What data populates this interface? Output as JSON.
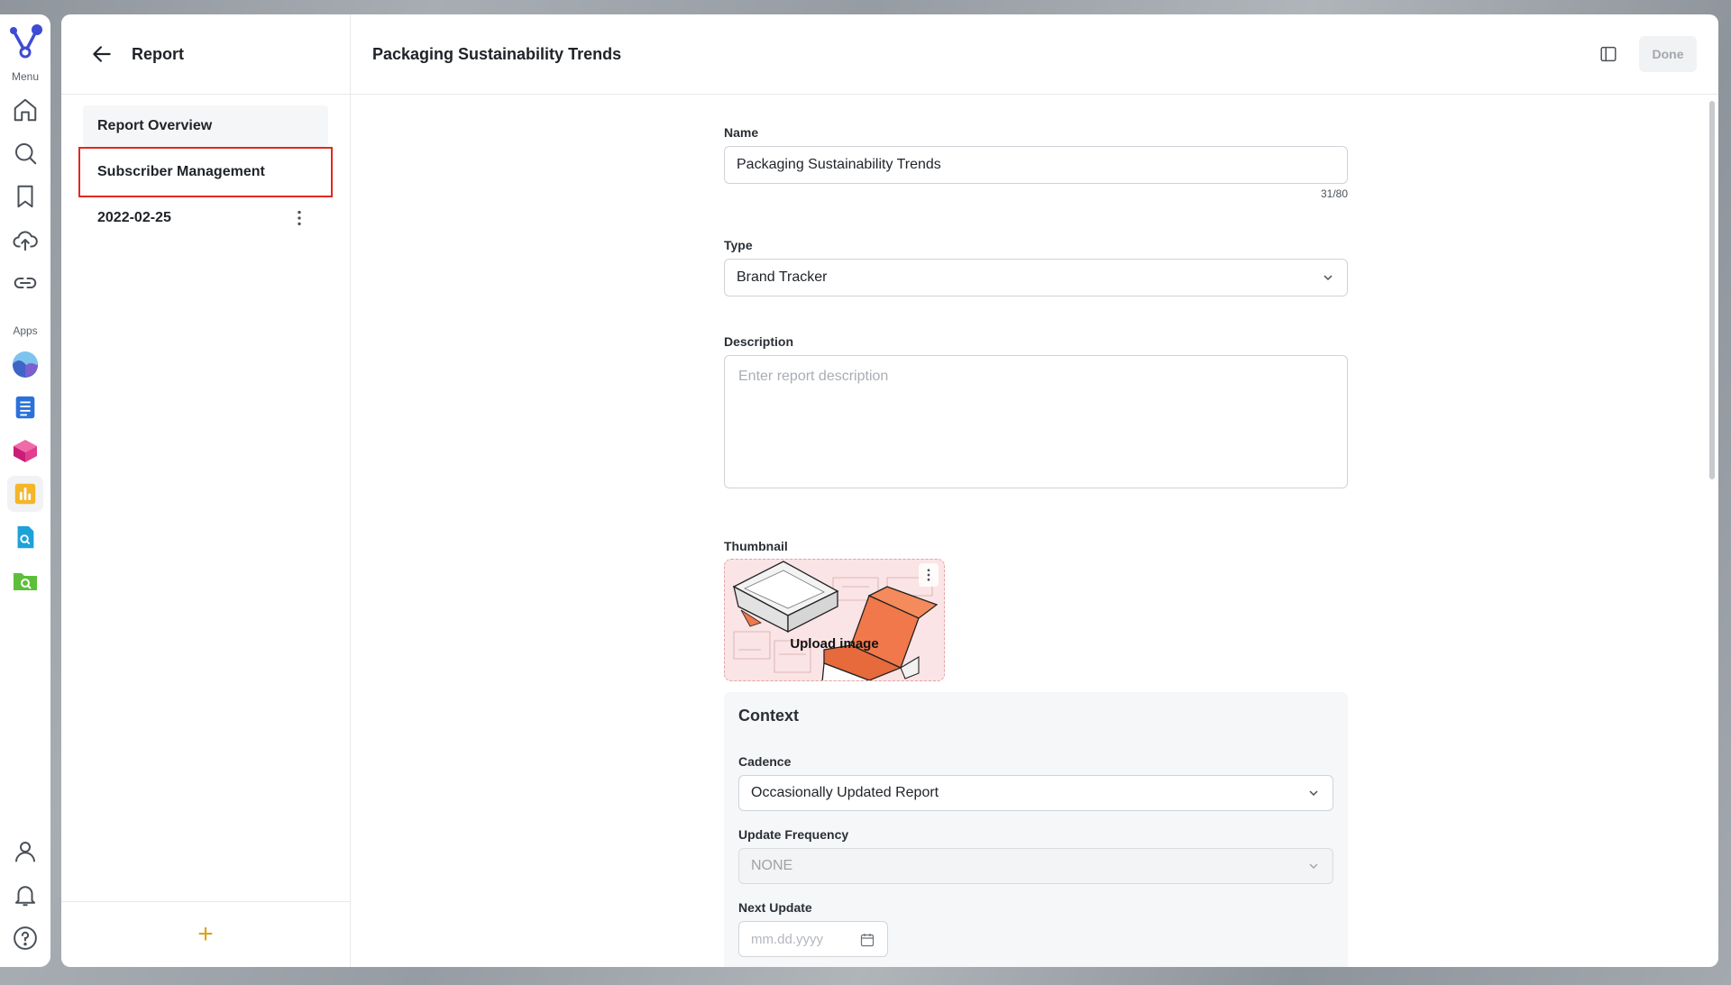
{
  "rail": {
    "menu_label": "Menu",
    "apps_label": "Apps",
    "nav_icons": [
      "home-icon",
      "search-icon",
      "bookmark-icon",
      "upload-cloud-icon",
      "link-icon"
    ],
    "app_icons": [
      "wave-app-icon",
      "document-app-icon",
      "cube-app-icon",
      "bar-chart-app-icon",
      "file-search-app-icon",
      "folder-search-app-icon"
    ],
    "bottom_icons": [
      "user-icon",
      "bell-icon",
      "help-icon"
    ]
  },
  "sidebar": {
    "title": "Report",
    "items": [
      {
        "label": "Report Overview"
      },
      {
        "label": "Subscriber Management"
      },
      {
        "label": "2022-02-25"
      }
    ],
    "add_label": "+"
  },
  "header": {
    "title": "Packaging Sustainability Trends",
    "done_label": "Done"
  },
  "form": {
    "name_label": "Name",
    "name_value": "Packaging Sustainability Trends",
    "name_counter": "31/80",
    "type_label": "Type",
    "type_value": "Brand Tracker",
    "description_label": "Description",
    "description_placeholder": "Enter report description",
    "thumbnail_label": "Thumbnail",
    "upload_label": "Upload image"
  },
  "context": {
    "title": "Context",
    "cadence_label": "Cadence",
    "cadence_value": "Occasionally Updated Report",
    "frequency_label": "Update Frequency",
    "frequency_value": "NONE",
    "next_update_label": "Next Update",
    "next_update_placeholder": "mm.dd.yyyy"
  },
  "colors": {
    "accent_blue": "#3d4bd6",
    "highlight_red": "#e0291f",
    "add_orange": "#e0a21a",
    "thumbnail_orange": "#f0784a"
  }
}
